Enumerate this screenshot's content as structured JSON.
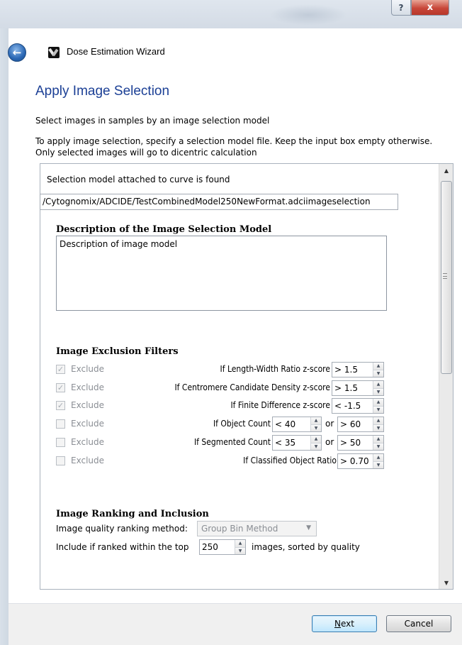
{
  "window": {
    "title": "Dose Estimation Wizard",
    "help_glyph": "?",
    "close_glyph": "x"
  },
  "page": {
    "title": "Apply Image Selection",
    "subtitle": "Select images in samples by an image selection model",
    "instruction_line1": "To apply image selection, specify a selection model file. Keep the input box empty otherwise.",
    "instruction_line2": "Only selected images will go to dicentric calculation"
  },
  "panel": {
    "found_label": "Selection model attached to curve is found",
    "model_path": "/Cytognomix/ADCIDE/TestCombinedModel250NewFormat.adciimageselection",
    "description_title": "Description of the Image Selection Model",
    "description_text": "Description of image model",
    "exclusion_title": "Image Exclusion Filters",
    "filters": [
      {
        "checked": true,
        "check_label": "Exclude",
        "condition": "If Length-Width Ratio z-score",
        "value": "> 1.5"
      },
      {
        "checked": true,
        "check_label": "Exclude",
        "condition": "If Centromere Candidate Density z-score",
        "value": "> 1.5"
      },
      {
        "checked": true,
        "check_label": "Exclude",
        "condition": "If Finite Difference z-score",
        "value": "< -1.5"
      },
      {
        "checked": false,
        "check_label": "Exclude",
        "condition": "If Object Count",
        "value": "< 40",
        "or_label": "or",
        "value2": "> 60"
      },
      {
        "checked": false,
        "check_label": "Exclude",
        "condition": "If Segmented Count",
        "value": "< 35",
        "or_label": "or",
        "value2": "> 50"
      },
      {
        "checked": false,
        "check_label": "Exclude",
        "condition": "If Classified Object Ratio",
        "value": "> 0.70"
      }
    ],
    "ranking_title": "Image Ranking and Inclusion",
    "ranking_method_label": "Image quality ranking method:",
    "ranking_method_value": "Group Bin Method",
    "include_prefix": "Include if ranked within the top",
    "include_value": "250",
    "include_suffix": "images, sorted by quality"
  },
  "footer": {
    "next_mnemonic": "N",
    "next_rest": "ext",
    "cancel_label": "Cancel"
  },
  "icons": {
    "back": "back-arrow-icon",
    "app": "app-logo-icon",
    "check": "checkmark-icon",
    "spin_up": "spin-up-icon",
    "spin_down": "spin-down-icon",
    "dropdown": "chevron-down-icon"
  },
  "colors": {
    "title_blue": "#1b3f95",
    "close_red": "#c8473a",
    "disabled_text": "#8a8e94"
  }
}
